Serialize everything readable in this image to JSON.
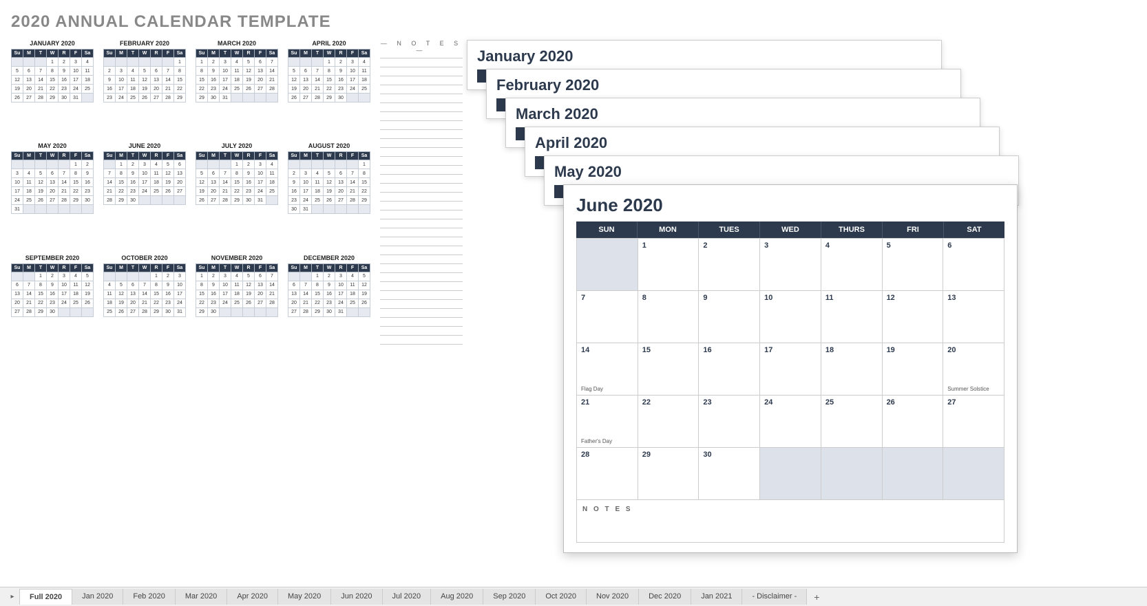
{
  "title": "2020 ANNUAL CALENDAR TEMPLATE",
  "notesLabel": "— N O T E S —",
  "dayHeadersMini": [
    "Su",
    "M",
    "T",
    "W",
    "R",
    "F",
    "Sa"
  ],
  "dayHeadersBig": [
    "SUN",
    "MON",
    "TUES",
    "WED",
    "THURS",
    "FRI",
    "SAT"
  ],
  "miniMonths": [
    {
      "name": "JANUARY 2020",
      "start": 3,
      "days": 31
    },
    {
      "name": "FEBRUARY 2020",
      "start": 6,
      "days": 29
    },
    {
      "name": "MARCH 2020",
      "start": 0,
      "days": 31
    },
    {
      "name": "APRIL 2020",
      "start": 3,
      "days": 30
    },
    {
      "name": "MAY 2020",
      "start": 5,
      "days": 31
    },
    {
      "name": "JUNE 2020",
      "start": 1,
      "days": 30
    },
    {
      "name": "JULY 2020",
      "start": 3,
      "days": 31
    },
    {
      "name": "AUGUST 2020",
      "start": 6,
      "days": 31
    },
    {
      "name": "SEPTEMBER 2020",
      "start": 2,
      "days": 30
    },
    {
      "name": "OCTOBER 2020",
      "start": 4,
      "days": 31
    },
    {
      "name": "NOVEMBER 2020",
      "start": 0,
      "days": 30
    },
    {
      "name": "DECEMBER 2020",
      "start": 2,
      "days": 31
    }
  ],
  "stackCards": [
    {
      "title": "January 2020"
    },
    {
      "title": "February 2020"
    },
    {
      "title": "March 2020"
    },
    {
      "title": "April 2020"
    },
    {
      "title": "May 2020"
    }
  ],
  "bigMonth": {
    "title": "June 2020",
    "start": 1,
    "days": 30,
    "events": {
      "14": "Flag Day",
      "20": "Summer Solstice",
      "21": "Father's Day"
    },
    "notesLabel": "N O T E S"
  },
  "tabs": [
    "Full 2020",
    "Jan 2020",
    "Feb 2020",
    "Mar 2020",
    "Apr 2020",
    "May 2020",
    "Jun 2020",
    "Jul 2020",
    "Aug 2020",
    "Sep 2020",
    "Oct 2020",
    "Nov 2020",
    "Dec 2020",
    "Jan 2021",
    "- Disclaimer -"
  ],
  "activeTab": 0
}
